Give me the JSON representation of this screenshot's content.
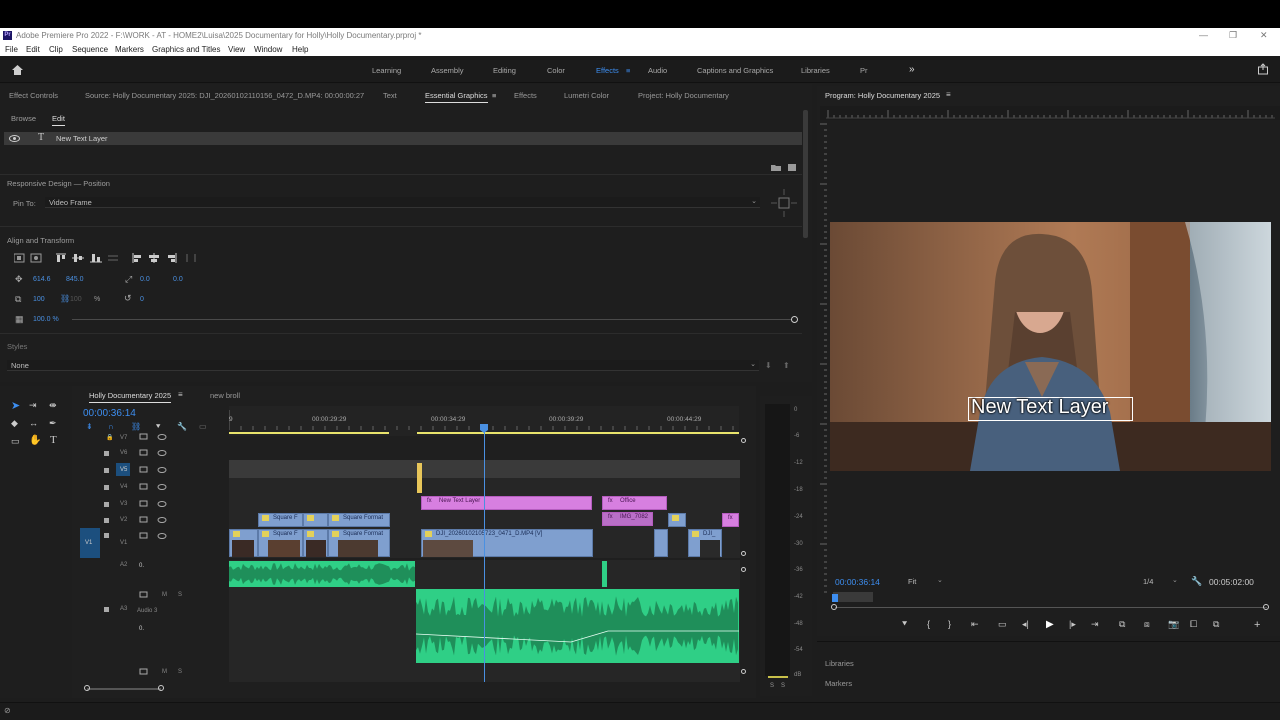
{
  "window": {
    "title": "Adobe Premiere Pro 2022 - F:\\WORK - AT - HOME2\\Luisa\\2025 Documentary for Holly\\Holly Documentary.prproj *",
    "app_icon": "Pr"
  },
  "menu": [
    "File",
    "Edit",
    "Clip",
    "Sequence",
    "Markers",
    "Graphics and Titles",
    "View",
    "Window",
    "Help"
  ],
  "workspaces": [
    "Learning",
    "Assembly",
    "Editing",
    "Color",
    "Effects",
    "Audio",
    "Captions and Graphics",
    "Libraries",
    "Pr"
  ],
  "active_workspace": "Effects",
  "panel_tabs": {
    "effect_controls": "Effect Controls",
    "source": "Source: Holly Documentary 2025: DJI_20260102110156_0472_D.MP4: 00:00:00:27",
    "text": "Text",
    "essential_graphics": "Essential Graphics",
    "effects": "Effects",
    "lumetri": "Lumetri Color",
    "project": "Project: Holly Documentary"
  },
  "essential_graphics": {
    "browse": "Browse",
    "edit": "Edit",
    "layer_name": "New Text Layer",
    "responsive_title": "Responsive Design — Position",
    "pin_to_label": "Pin To:",
    "pin_to_value": "Video Frame",
    "align_title": "Align and Transform",
    "pos_x": "614.6",
    "pos_y": "845.0",
    "anchor_x": "0.0",
    "anchor_y": "0.0",
    "scale_w": "100",
    "scale_h": "100",
    "scale_unit": "%",
    "rotation": "0",
    "opacity": "100.0 %",
    "styles_title": "Styles",
    "style_value": "None"
  },
  "program": {
    "title": "Program: Holly Documentary 2025",
    "overlay_text": "New Text Layer",
    "timecode": "00:00:36:14",
    "fit": "Fit",
    "resolution": "1/4",
    "duration": "00:05:02:00",
    "libraries": "Libraries",
    "markers": "Markers"
  },
  "timeline": {
    "sequence_tab": "Holly Documentary 2025",
    "other_tab": "new broll",
    "timecode": "00:00:36:14",
    "ruler": [
      "00:00:29:29",
      "00:00:34:29",
      "00:00:39:29",
      "00:00:44:29"
    ],
    "ruler_start": "9",
    "video_tracks": [
      "V7",
      "V6",
      "V5",
      "V4",
      "V3",
      "V2",
      "V1"
    ],
    "v1_source": "V1",
    "audio_tracks": [
      "A2",
      "A3"
    ],
    "audio3_name": "Audio 3",
    "mute": "M",
    "solo": "S",
    "audio_zero": "0.",
    "clips": {
      "text_layer": "New Text Layer",
      "office": "Office",
      "img": "IMG_7082",
      "square1": "Square F",
      "square2": "Square Format",
      "square3": "Square F",
      "square4": "Square Format",
      "dji_main": "DJI_20260102105723_0471_D.MP4 [V]",
      "dji_end": "DJI_"
    },
    "db_scale": [
      "0",
      "-6",
      "-12",
      "-18",
      "-24",
      "-30",
      "-36",
      "-42",
      "-48",
      "-54",
      "dB"
    ],
    "meter_solo": "S",
    "meter_solo2": "S"
  },
  "colors": {
    "accent_blue": "#3d8ef0",
    "video_clip": "#7f9fcf",
    "text_clip": "#d77fe0",
    "audio_clip": "#2fcf86",
    "playhead": "#4a90e2"
  }
}
